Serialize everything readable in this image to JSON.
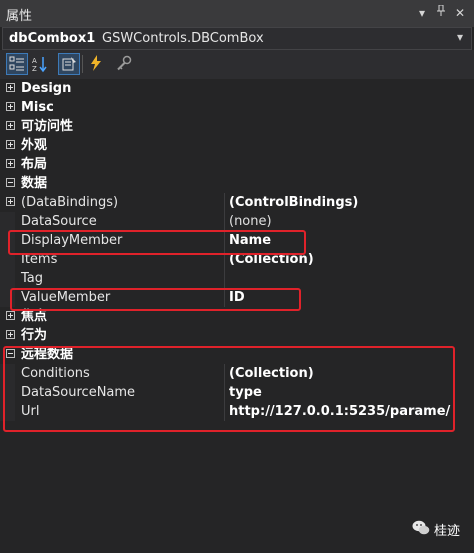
{
  "window": {
    "title": "属性"
  },
  "object_selector": {
    "name": "dbCombox1",
    "type": "GSWControls.DBComBox"
  },
  "toolbar": {
    "icons": [
      "categorized-icon",
      "alphabetical-icon",
      "properties-icon",
      "events-icon",
      "property-pages-icon"
    ]
  },
  "grid": {
    "categories_top": [
      {
        "label": "Design"
      },
      {
        "label": "Misc"
      },
      {
        "label": "可访问性"
      },
      {
        "label": "外观"
      },
      {
        "label": "布局"
      }
    ],
    "data_category": {
      "label": "数据",
      "props": [
        {
          "name": "(DataBindings)",
          "value": "(ControlBindings)"
        },
        {
          "name": "DataSource",
          "value": "(none)"
        },
        {
          "name": "DisplayMember",
          "value": "Name"
        },
        {
          "name": "Items",
          "value": "(Collection)"
        },
        {
          "name": "Tag",
          "value": ""
        },
        {
          "name": "ValueMember",
          "value": "ID"
        }
      ]
    },
    "categories_mid": [
      {
        "label": "焦点"
      },
      {
        "label": "行为"
      }
    ],
    "remote_category": {
      "label": "远程数据",
      "props": [
        {
          "name": "Conditions",
          "value": "(Collection)"
        },
        {
          "name": "DataSourceName",
          "value": "type"
        },
        {
          "name": "Url",
          "value": "http://127.0.0.1:5235/parame/"
        }
      ]
    }
  },
  "watermark": {
    "text": "桂迹"
  }
}
